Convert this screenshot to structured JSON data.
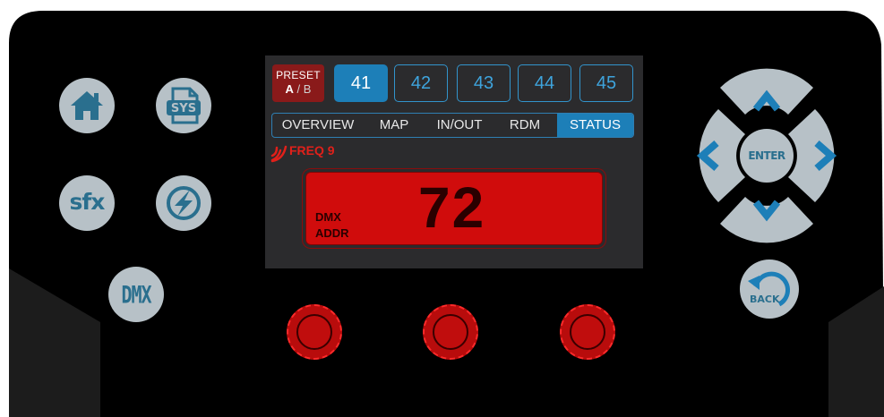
{
  "left_panel": {
    "home_icon": "home-icon",
    "sys_label": "SYS",
    "sfx_label": "sfx",
    "power_icon": "lightning-icon",
    "dmx_label": "DMX"
  },
  "screen": {
    "preset_toggle": {
      "title": "PRESET",
      "option_a": "A",
      "separator": "/",
      "option_b": "B"
    },
    "presets": [
      {
        "label": "41",
        "active": true
      },
      {
        "label": "42",
        "active": false
      },
      {
        "label": "43",
        "active": false
      },
      {
        "label": "44",
        "active": false
      },
      {
        "label": "45",
        "active": false
      }
    ],
    "tabs": [
      {
        "label": "OVERVIEW",
        "active": false
      },
      {
        "label": "MAP",
        "active": false
      },
      {
        "label": "IN/OUT",
        "active": false
      },
      {
        "label": "RDM",
        "active": false
      },
      {
        "label": "STATUS",
        "active": true
      }
    ],
    "frequency": "FREQ 9",
    "readout": {
      "label_line1": "DMX",
      "label_line2": "ADDR",
      "value": "72"
    }
  },
  "right_panel": {
    "enter_label": "ENTER",
    "back_label": "BACK"
  },
  "colors": {
    "body": "#000000",
    "button_face": "#b7c1c7",
    "icon_blue": "#2a6f8e",
    "accent_blue": "#1d7fb8",
    "readout_red": "#d00c0c",
    "knob_red": "#b80c0c"
  }
}
